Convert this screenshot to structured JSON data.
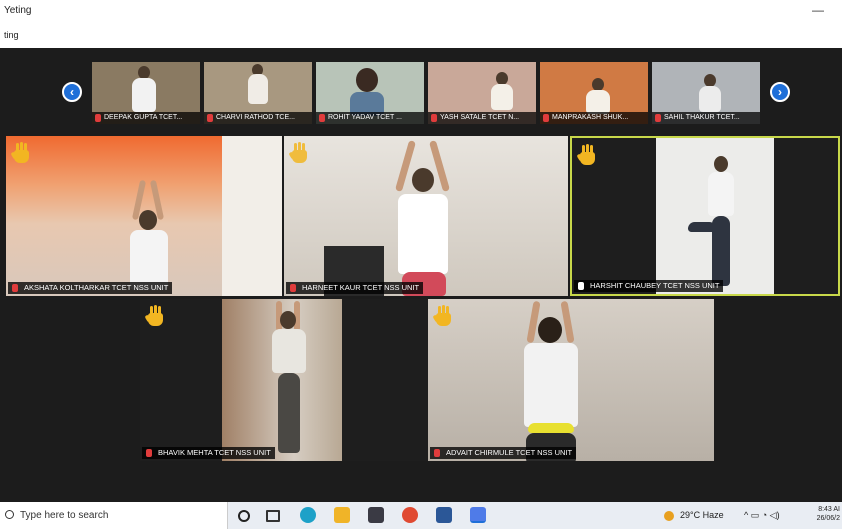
{
  "window": {
    "title": "Yeting",
    "sub_label": "ting",
    "minimize": "—"
  },
  "strip": {
    "participants": [
      {
        "name": "DEEPAK GUPTA TCET...",
        "bg": "#8a7a62"
      },
      {
        "name": "CHARVI RATHOD TCE...",
        "bg": "#a89880"
      },
      {
        "name": "ROHIT YADAV TCET ...",
        "bg": "#b8c4b8"
      },
      {
        "name": "YASH SATALE TCET N...",
        "bg": "#c9a899"
      },
      {
        "name": "MANPRAKASH SHUK...",
        "bg": "#d07a44"
      },
      {
        "name": "SAHIL THAKUR TCET...",
        "bg": "#b0b4b8"
      }
    ],
    "prev_icon": "chevron-left-icon",
    "next_icon": "chevron-right-icon"
  },
  "tiles": [
    {
      "name": "AKSHATA KOLTHARKAR TCET NSS UNIT",
      "bg": "#e9b08a"
    },
    {
      "name": "HARNEET KAUR TCET NSS UNIT",
      "bg": "#d8d4cc"
    },
    {
      "name": "HARSHIT CHAUBEY TCET NSS UNIT",
      "bg": "#e6e6e2"
    },
    {
      "name": "BHAVIK MEHTA TCET NSS UNIT",
      "bg": "#b89e86"
    },
    {
      "name": "ADVAIT CHIRMULE TCET NSS UNIT",
      "bg": "#c8c0b6"
    }
  ],
  "taskbar": {
    "search_placeholder": "Type here to search",
    "weather": "29°C Haze",
    "tray_icons": "^ ▭ ◔ ◁)",
    "time": "8:43 AI",
    "date": "26/06/2"
  },
  "colors": {
    "accent": "#1f6fd8",
    "speaker_border": "#c8d84a",
    "hand": "#f2b622"
  }
}
